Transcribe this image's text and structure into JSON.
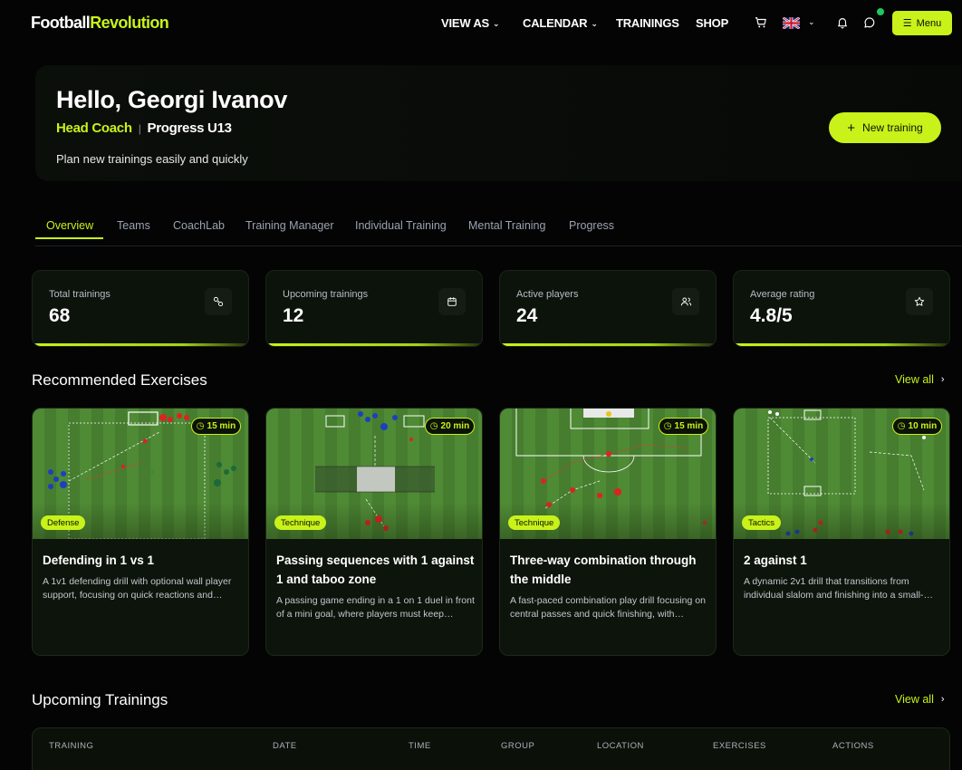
{
  "brand": {
    "part1": "Football",
    "part2": "Revolution"
  },
  "nav": {
    "view_as": "VIEW AS",
    "calendar": "CALENDAR",
    "trainings": "TRAININGS",
    "shop": "SHOP",
    "menu_label": "Menu"
  },
  "hero": {
    "greeting": "Hello, Georgi Ivanov",
    "role": "Head Coach",
    "separator": "|",
    "team": "Progress U13",
    "tagline": "Plan new trainings easily and quickly",
    "new_training_label": "New training"
  },
  "tabs": [
    "Overview",
    "Teams",
    "CoachLab",
    "Training Manager",
    "Individual Training",
    "Mental Training",
    "Progress"
  ],
  "stats": [
    {
      "label": "Total trainings",
      "value": "68",
      "icon": "balls-icon"
    },
    {
      "label": "Upcoming trainings",
      "value": "12",
      "icon": "calendar-icon"
    },
    {
      "label": "Active players",
      "value": "24",
      "icon": "users-icon"
    },
    {
      "label": "Average rating",
      "value": "4.8/5",
      "icon": "star-icon"
    }
  ],
  "recommended": {
    "title": "Recommended Exercises",
    "view_all": "View all",
    "exercises": [
      {
        "title": "Defending in 1 vs 1",
        "duration": "15 min",
        "category": "Defense",
        "description": "A 1v1 defending drill with optional wall player support, focusing on quick reactions and positioning."
      },
      {
        "title": "Passing sequences with 1 against 1 and taboo zone",
        "duration": "20 min",
        "category": "Technique",
        "description": "A passing game ending in a 1 on 1 duel in front of a mini goal, where players must keep possession."
      },
      {
        "title": "Three-way combination through the middle",
        "duration": "15 min",
        "category": "Technique",
        "description": "A fast-paced combination play drill focusing on central passes and quick finishing, with movement."
      },
      {
        "title": "2 against 1",
        "duration": "10 min",
        "category": "Tactics",
        "description": "A dynamic 2v1 drill that transitions from individual slalom and finishing into a small-sided duel."
      }
    ]
  },
  "upcoming": {
    "title": "Upcoming Trainings",
    "view_all": "View all",
    "columns": [
      "TRAINING",
      "DATE",
      "TIME",
      "GROUP",
      "LOCATION",
      "EXERCISES",
      "ACTIONS"
    ]
  },
  "colors": {
    "accent": "#c8f21a",
    "background": "#030403",
    "card": "#0d140b",
    "online": "#22c55e"
  }
}
